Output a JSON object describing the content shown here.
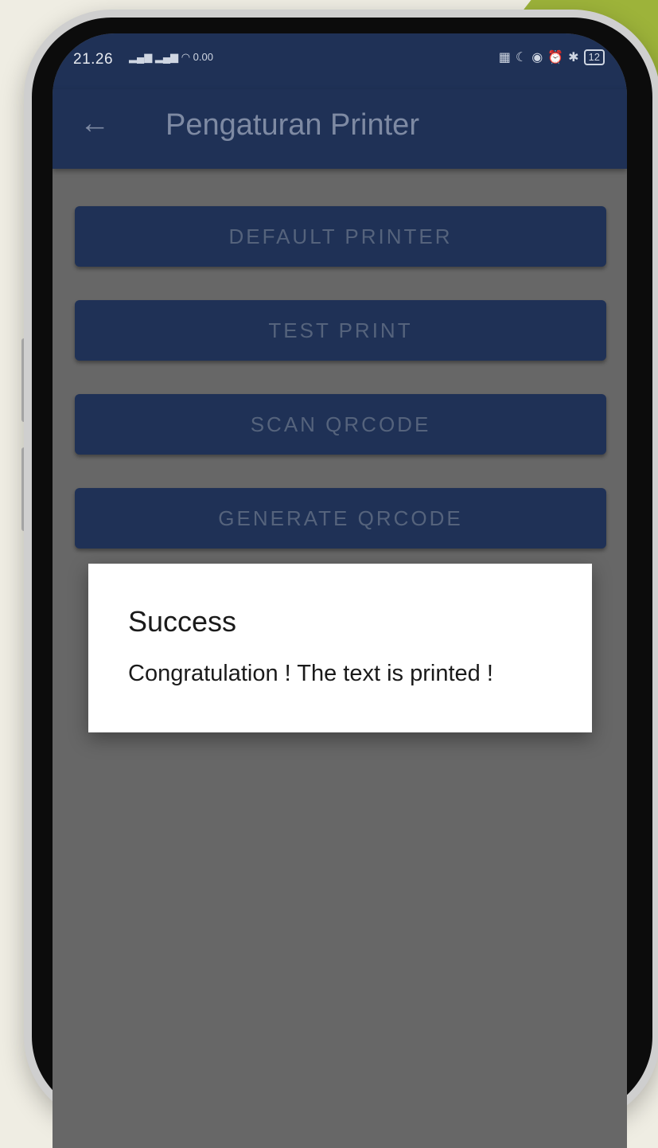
{
  "status_bar": {
    "time": "21.26",
    "left_icons": "signal-icon signal-icon wifi-icon",
    "data_rate": "0.00",
    "battery": "12"
  },
  "app_bar": {
    "title": "Pengaturan Printer",
    "back_icon": "arrow-back-icon"
  },
  "buttons": {
    "default_printer": "DEFAULT PRINTER",
    "test_print": "TEST PRINT",
    "scan_qrcode": "SCAN QRCODE",
    "generate_qrcode": "GENERATE QRCODE"
  },
  "dialog": {
    "title": "Success",
    "message": "Congratulation ! The text is printed !"
  },
  "colors": {
    "primary": "#1f3156",
    "scrim": "#676767",
    "accent": "#9db33a",
    "background": "#efede3"
  }
}
